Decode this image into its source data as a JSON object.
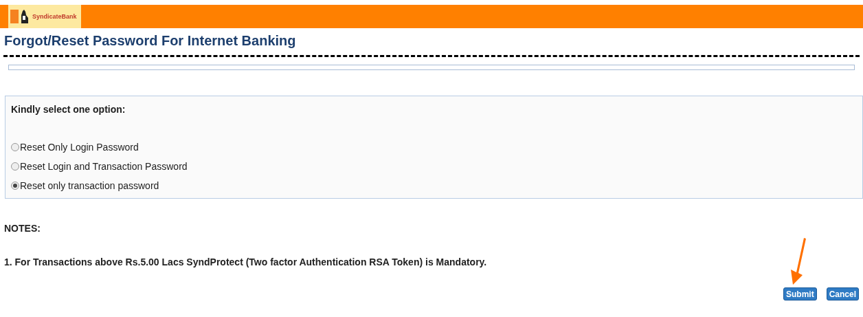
{
  "header": {
    "logo_text": "SyndicateBank"
  },
  "title": "Forgot/Reset Password For Internet Banking",
  "options_panel": {
    "prompt": "Kindly select one option:",
    "options": [
      {
        "label": "Reset Only Login Password",
        "selected": false
      },
      {
        "label": "Reset Login and Transaction Password",
        "selected": false
      },
      {
        "label": "Reset only transaction password",
        "selected": true
      }
    ]
  },
  "notes": {
    "heading": "NOTES:",
    "items": [
      "1. For Transactions above Rs.5.00 Lacs SyndProtect (Two factor Authentication RSA Token) is Mandatory."
    ]
  },
  "buttons": [
    "Submit",
    "Cancel"
  ]
}
